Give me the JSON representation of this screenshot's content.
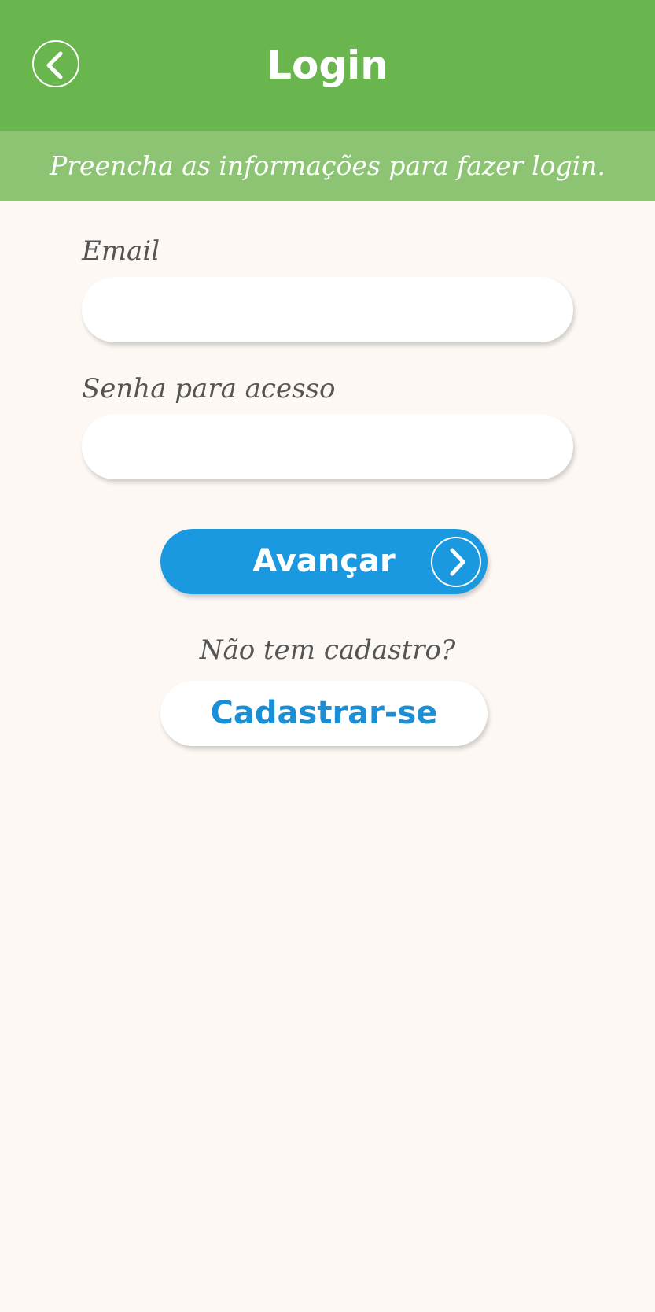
{
  "header": {
    "title": "Login",
    "back_icon": "chevron-left-icon",
    "background_color": "#6ab64e"
  },
  "subheader": {
    "text": "Preencha as informações para fazer login.",
    "background_color": "#8cc474"
  },
  "form": {
    "email": {
      "label": "Email",
      "value": "",
      "placeholder": ""
    },
    "password": {
      "label": "Senha para acesso",
      "value": "",
      "placeholder": ""
    }
  },
  "actions": {
    "submit_label": "Avançar",
    "submit_icon": "chevron-right-icon",
    "submit_color": "#1a98e0",
    "signup_prompt": "Não tem cadastro?",
    "signup_label": "Cadastrar-se",
    "signup_color": "#1a8fd6"
  }
}
